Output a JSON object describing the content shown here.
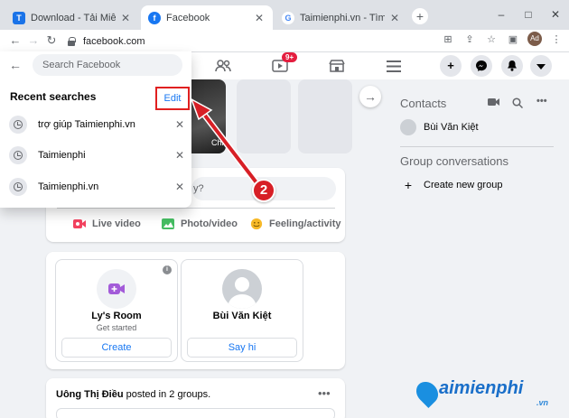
{
  "browser": {
    "tabs": [
      {
        "label": "Download - Tải Miễn Phí VN",
        "favicon": "T"
      },
      {
        "label": "Facebook",
        "favicon": "f"
      },
      {
        "label": "Taimienphi.vn - Tìm trên Goo",
        "favicon": "G"
      }
    ],
    "new_tab": "+",
    "url": "facebook.com",
    "window_controls": [
      "–",
      "□",
      "✕"
    ],
    "profile_initials": "Ad"
  },
  "header": {
    "watch_badge": "9+"
  },
  "search": {
    "placeholder": "Search Facebook",
    "recent_title": "Recent searches",
    "edit_label": "Edit",
    "items": [
      {
        "label": "trợ giúp Taimienphi.vn"
      },
      {
        "label": "Taimienphi"
      },
      {
        "label": "Taimienphi.vn"
      }
    ]
  },
  "feed": {
    "story_caption": "Chim",
    "whats_on_mind_fragment": "y?",
    "actions": [
      {
        "label": "Live video",
        "color": "#f3425f"
      },
      {
        "label": "Photo/video",
        "color": "#45bd62"
      },
      {
        "label": "Feeling/activity",
        "color": "#f7b928"
      }
    ],
    "rooms": [
      {
        "name": "Ly's Room",
        "sub": "Get started",
        "button": "Create"
      },
      {
        "name": "Bùi Văn Kiệt",
        "sub": "",
        "button": "Say hi"
      }
    ],
    "post_user": "Uông Thị Điều",
    "post_suffix": " posted in 2 groups.",
    "post_more": "•••"
  },
  "sidebar": {
    "contacts_title": "Contacts",
    "contacts": [
      {
        "name": "Bùi Văn Kiệt"
      }
    ],
    "groups_title": "Group conversations",
    "create_group": "Create new group"
  },
  "annotation": {
    "step_number": "2",
    "color": "#d71f26"
  },
  "watermark": {
    "brand": "aimienphi",
    "suffix": ".vn"
  }
}
